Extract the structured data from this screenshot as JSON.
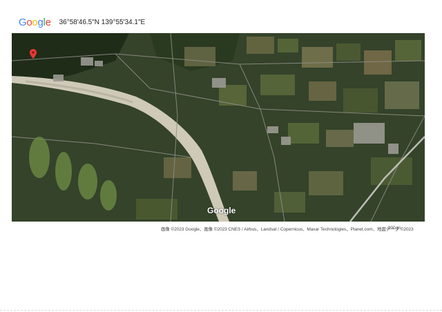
{
  "header": {
    "logo_text": "Google",
    "coordinates": "36°58'46.5\"N 139°55'34.1\"E"
  },
  "map": {
    "type": "satellite",
    "watermark": "Google",
    "pin_color": "#e53935",
    "attribution": "画像 ©2023 Google、画像 ©2023 CNES / Airbus、Landsat / Copernicus、Maxar Technologies、Planet.com、地図データ ©2023",
    "scale_label": "200 m"
  }
}
